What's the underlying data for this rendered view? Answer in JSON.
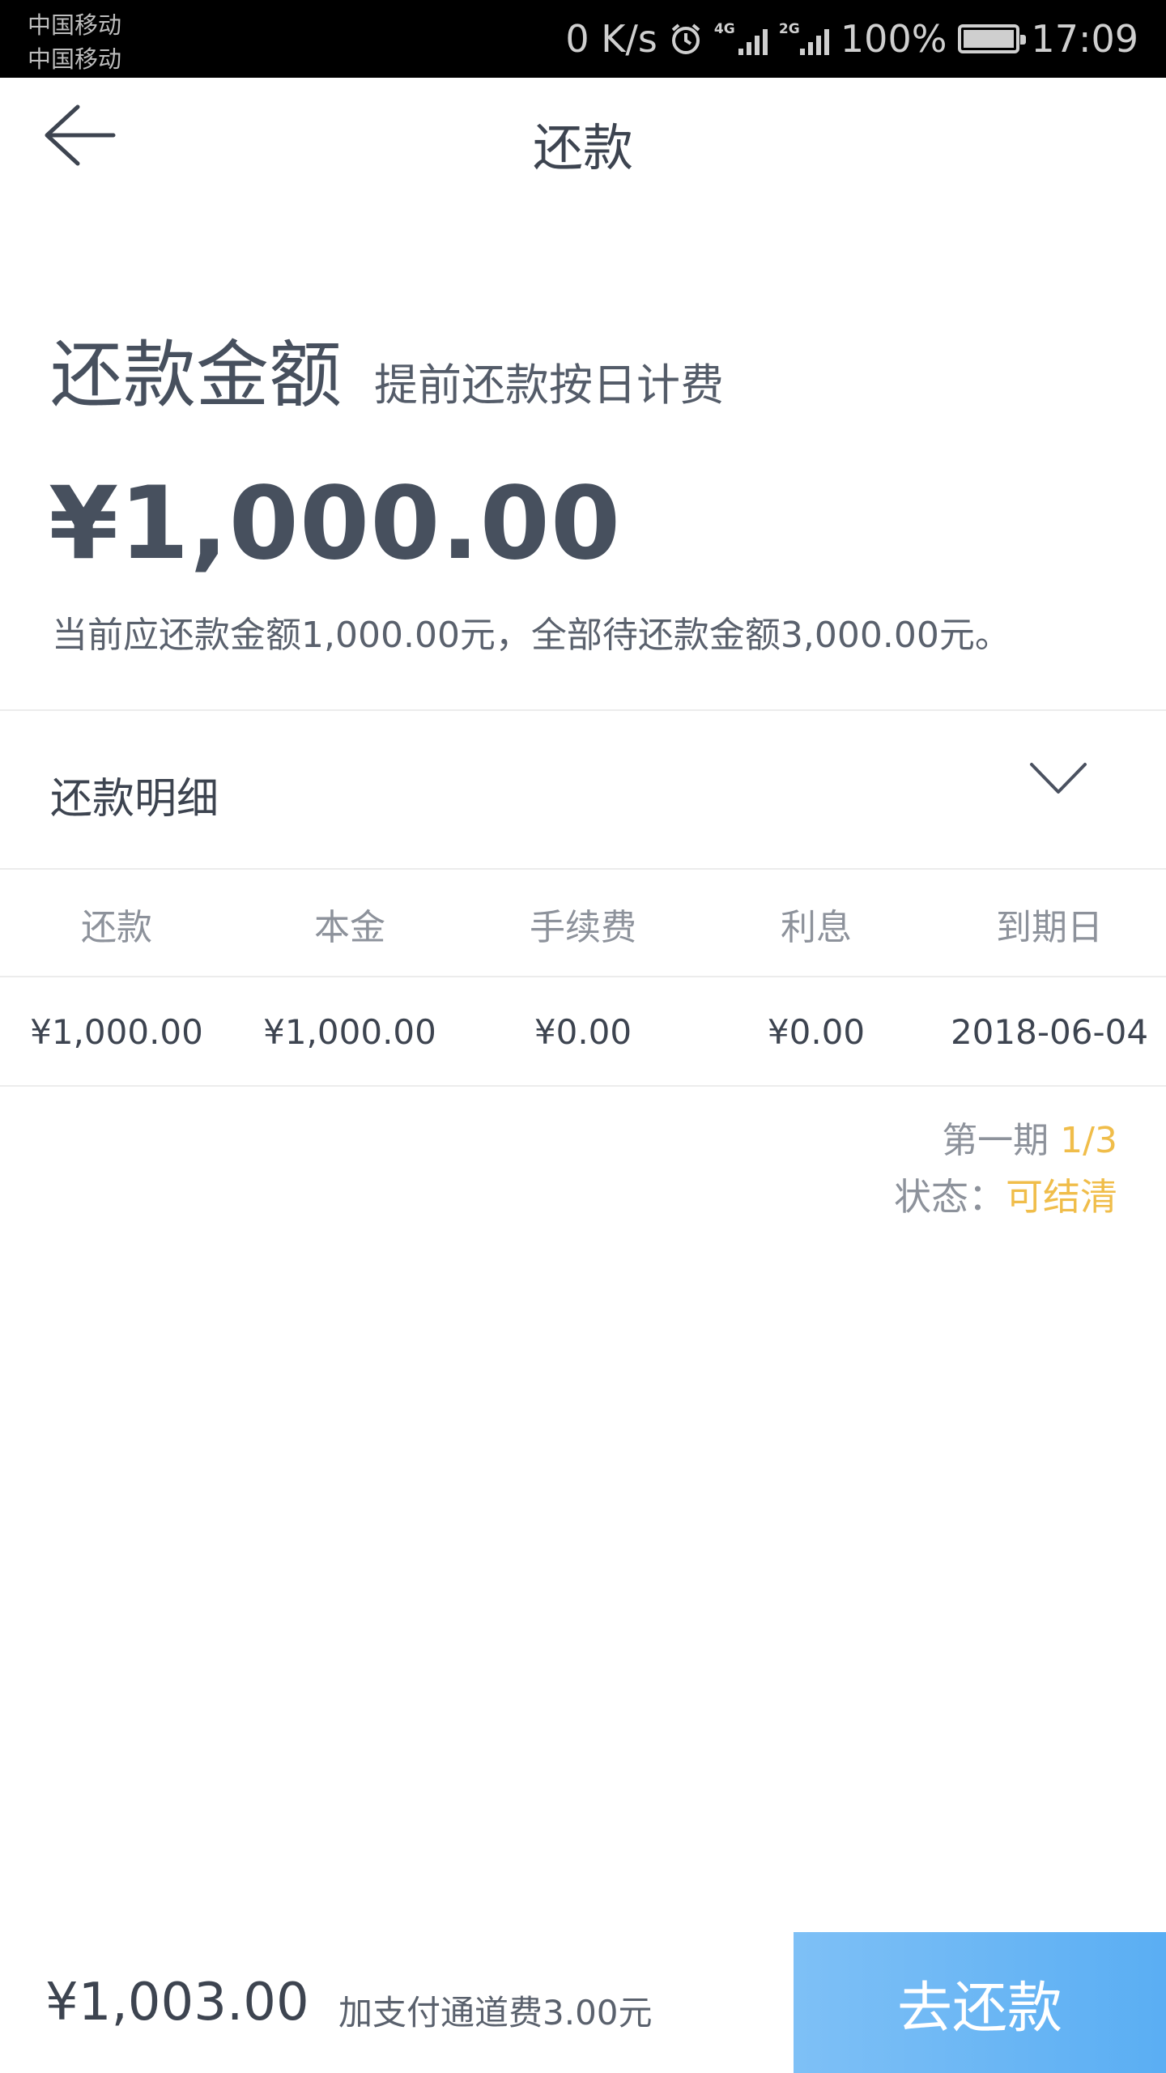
{
  "status_bar": {
    "carrier_1": "中国移动",
    "carrier_2": "中国移动",
    "speed": "0 K/s",
    "network_1": "4G",
    "network_2": "2G",
    "battery": "100%",
    "time": "17:09"
  },
  "header": {
    "title": "还款",
    "back_icon": "arrow-left-icon"
  },
  "amount": {
    "heading": "还款金额",
    "subheading": "提前还款按日计费",
    "value": "¥1,000.00",
    "summary": "当前应还款金额1,000.00元，全部待还款金额3,000.00元。"
  },
  "detail": {
    "label": "还款明细",
    "toggle_icon": "chevron-down-icon"
  },
  "table": {
    "headers": [
      "还款",
      "本金",
      "手续费",
      "利息",
      "到期日"
    ],
    "row": [
      "¥1,000.00",
      "¥1,000.00",
      "¥0.00",
      "¥0.00",
      "2018-06-04"
    ]
  },
  "period": {
    "label": "第一期",
    "value": "1/3"
  },
  "status": {
    "label": "状态：",
    "value": "可结清"
  },
  "bottom_bar": {
    "total": "¥1,003.00",
    "fee_note": "加支付通道费3.00元",
    "pay_button": "去还款"
  },
  "colors": {
    "accent_yellow": "#f0bd4a",
    "button_blue": "#6bb6f4",
    "text_dark": "#47505e"
  }
}
